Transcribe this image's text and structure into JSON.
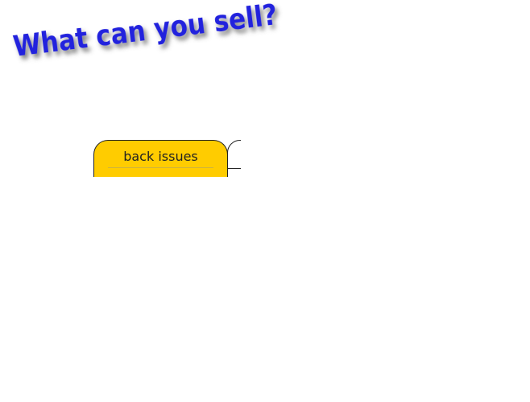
{
  "heading": {
    "text": "What can you sell?"
  },
  "tabs": [
    {
      "label": "back issues",
      "active": true
    },
    {
      "label": "",
      "active": false
    }
  ],
  "colors": {
    "heading": "#2222dd",
    "active_tab": "#ffcc00",
    "tab_border": "#222222"
  }
}
